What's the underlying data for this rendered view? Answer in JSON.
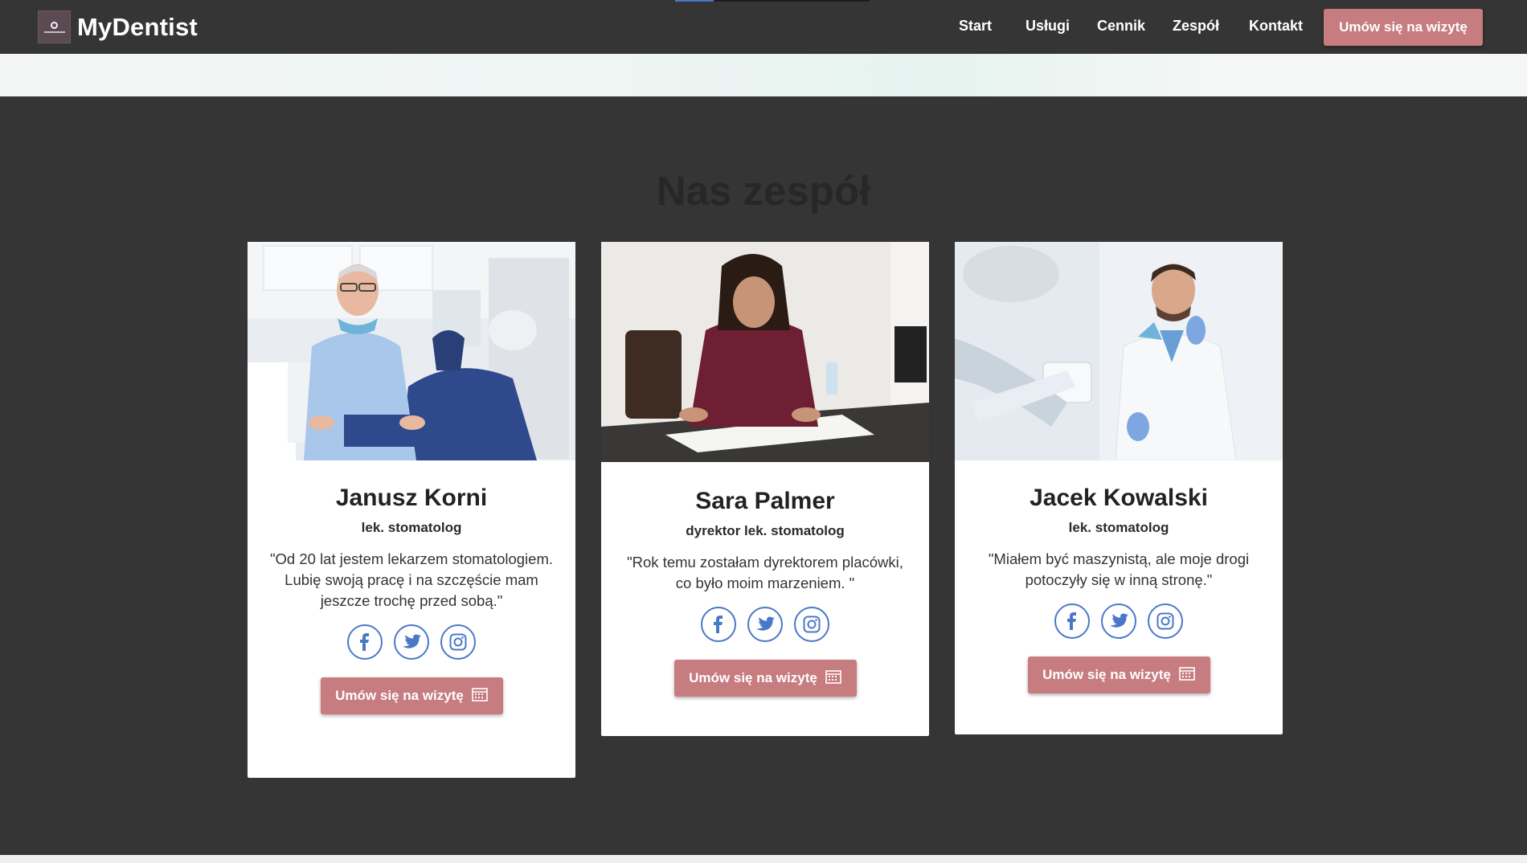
{
  "brand": {
    "name": "MyDentist",
    "logo_icon": "tooth-logo-icon"
  },
  "nav": {
    "links": [
      "Start",
      "Usługi",
      "Cennik",
      "Zespół",
      "Kontakt"
    ],
    "cta": "Umów się na wizytę"
  },
  "section": {
    "title": "Nas zespół"
  },
  "team": [
    {
      "name": "Janusz Korni",
      "role": "lek. stomatolog",
      "quote": "\"Od 20 lat jestem lekarzem stomatologiem. Lubię swoją pracę i na szczęście mam jeszcze trochę przed sobą.\"",
      "button": "Umów się na wizytę"
    },
    {
      "name": "Sara Palmer",
      "role": "dyrektor lek. stomatolog",
      "quote": "\"Rok temu zostałam dyrektorem placówki, co było moim marzeniem. \"",
      "button": "Umów się na wizytę"
    },
    {
      "name": "Jacek Kowalski",
      "role": "lek. stomatolog",
      "quote": "\"Miałem być maszynistą, ale moje drogi potoczyły się w inną stronę.\"",
      "button": "Umów się na wizytę"
    }
  ],
  "social_icons": [
    "facebook-icon",
    "twitter-icon",
    "instagram-icon"
  ],
  "colors": {
    "background": "#353535",
    "accent": "#c77c80",
    "social_blue": "#4a78c8",
    "card": "#ffffff",
    "title": "#272727"
  }
}
